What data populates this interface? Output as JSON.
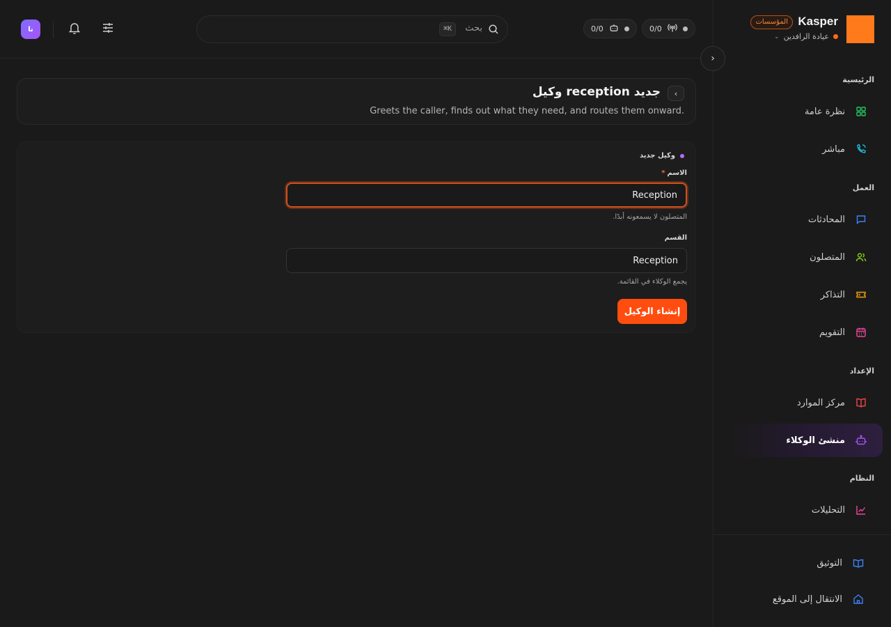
{
  "brand": {
    "name": "Kasper",
    "badge": "المؤسسات",
    "workspace": "عيادة الرافدين",
    "logo_color": "#ff7a1a"
  },
  "topbar": {
    "avatar_initials": "نا",
    "search_placeholder": "بحث",
    "search_shortcut": "⌘K",
    "status_pills": [
      {
        "icon": "broadcast-icon",
        "value": "0/0"
      },
      {
        "icon": "robot-icon",
        "value": "0/0"
      }
    ]
  },
  "sidebar": {
    "sections": [
      {
        "label": "الرئيسية"
      },
      {
        "label": "العمل"
      },
      {
        "label": "الإعداد"
      },
      {
        "label": "النظام"
      }
    ],
    "items": [
      {
        "label": "نظرة عامة",
        "icon": "grid-icon",
        "color": "#22c55e"
      },
      {
        "label": "مباشر",
        "icon": "phone-icon",
        "color": "#22b8cf"
      },
      {
        "label": "المحادثات",
        "icon": "chat-icon",
        "color": "#3b82f6"
      },
      {
        "label": "المتصلون",
        "icon": "users-icon",
        "color": "#84cc16"
      },
      {
        "label": "التذاكر",
        "icon": "ticket-icon",
        "color": "#f59e0b"
      },
      {
        "label": "التقويم",
        "icon": "calendar-icon",
        "color": "#ec4899"
      },
      {
        "label": "مركز الموارد",
        "icon": "book-icon",
        "color": "#ef4444"
      },
      {
        "label": "منشئ الوكلاء",
        "icon": "robot-icon",
        "color": "#a855f7",
        "active": true
      },
      {
        "label": "التحليلات",
        "icon": "chart-icon",
        "color": "#ec4899"
      }
    ],
    "footer": [
      {
        "label": "التوثيق",
        "icon": "book-open-icon",
        "color": "#3b82f6"
      },
      {
        "label": "الانتقال إلى الموقع",
        "icon": "home-icon",
        "color": "#3b82f6"
      }
    ]
  },
  "page": {
    "title": "وكيل reception جديد",
    "subtitle": "Greets the caller, finds out what they need, and routes them onward."
  },
  "form": {
    "section_title": "وكيل جديد",
    "name_label": "الاسم",
    "name_required": "*",
    "name_value": "Reception",
    "name_hint": "المتصلون لا يسمعونه أبدًا.",
    "department_label": "القسم",
    "department_value": "Reception",
    "department_hint": "يجمع الوكلاء في القائمة.",
    "submit_label": "إنشاء الوكيل"
  },
  "colors": {
    "accent": "#ff4d0f",
    "background": "#1a1a1a"
  }
}
